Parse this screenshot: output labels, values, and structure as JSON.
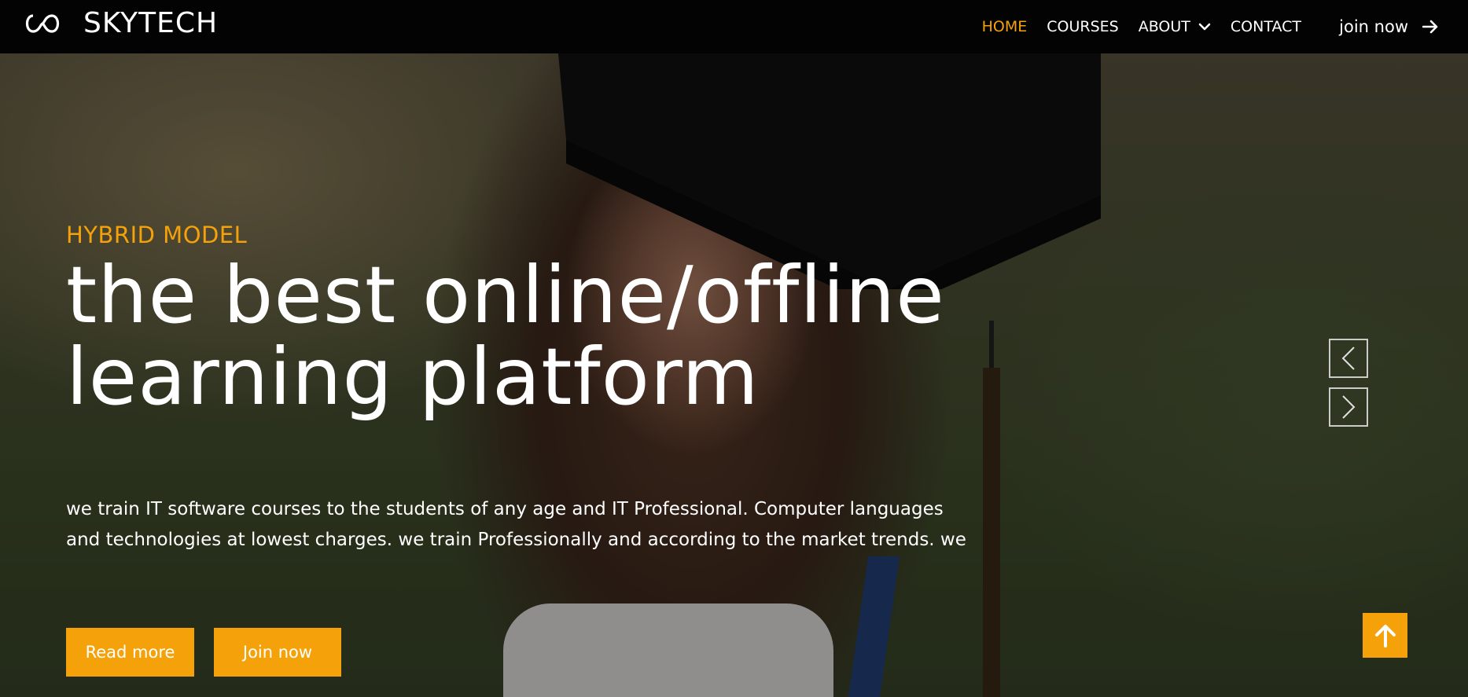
{
  "navbar": {
    "brand_name": "SKYTECH",
    "logo_icon": "infinity-icon",
    "links": [
      {
        "label": "HOME",
        "active": true
      },
      {
        "label": "COURSES",
        "active": false
      },
      {
        "label": "ABOUT",
        "active": false,
        "dropdown": true
      },
      {
        "label": "CONTACT",
        "active": false
      }
    ],
    "join_label": "join now",
    "join_icon": "arrow-right-icon"
  },
  "hero": {
    "eyebrow": "HYBRID MODEL",
    "headline_line1": "the best online/offline",
    "headline_line2": "learning platform",
    "description": "we train IT software courses to the students of any age and IT Professional. Computer languages and technologies at lowest charges. we train Professionally and according to the market trends. we",
    "read_more_label": "Read more",
    "join_now_label": "Join now"
  },
  "slider": {
    "prev_icon": "chevron-left-icon",
    "next_icon": "chevron-right-icon"
  },
  "scroll_top_icon": "arrow-up-icon",
  "colors": {
    "accent": "#f5a20a",
    "navbar_bg": "#030303",
    "text": "#ffffff"
  }
}
